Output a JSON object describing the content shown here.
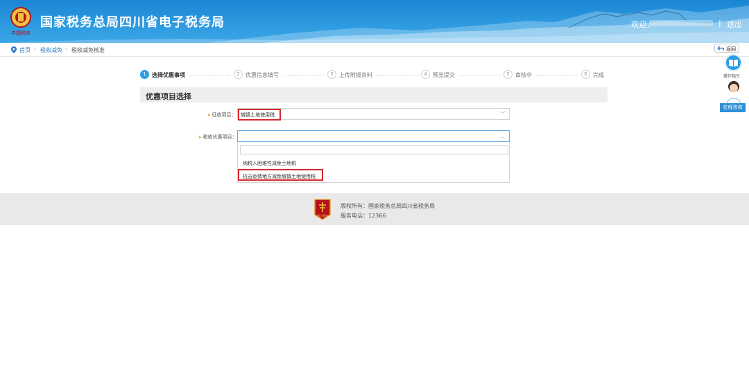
{
  "header": {
    "title": "国家税务总局四川省电子税务局",
    "logo_text": "中国税务",
    "welcome": "欢迎，",
    "separator": "|",
    "logout": "退出"
  },
  "breadcrumb": {
    "items": [
      "首页",
      "税收减免",
      "税收减免核准"
    ]
  },
  "back_label": "返回",
  "side": {
    "guide_label": "操作指引",
    "online_label": "在线咨询"
  },
  "steps": [
    {
      "num": "1",
      "label": "选择优惠事项",
      "active": true
    },
    {
      "num": "2",
      "label": "优惠信息填写",
      "active": false
    },
    {
      "num": "3",
      "label": "上传附报资料",
      "active": false
    },
    {
      "num": "4",
      "label": "预览提交",
      "active": false
    },
    {
      "num": "5",
      "label": "审核中",
      "active": false
    },
    {
      "num": "6",
      "label": "完成",
      "active": false
    }
  ],
  "section_title": "优惠项目选择",
  "form": {
    "levy_label": "征收项目：",
    "levy_value": "城镇土地使用税",
    "tax_pref_label": "税收优惠项目：",
    "tax_pref_value": "",
    "dropdown_options": [
      "纳税人困难性减免土地税",
      "抗击疫情地方减免城镇土地使用税"
    ]
  },
  "footer": {
    "copyright": "版权所有：国家税务总局四川省税务局",
    "phone": "服务电话：12366",
    "logo_text": "四川税务"
  },
  "colors": {
    "header": "#2d9ae0",
    "accent": "#2c9de2",
    "highlight": "#d9282f"
  }
}
